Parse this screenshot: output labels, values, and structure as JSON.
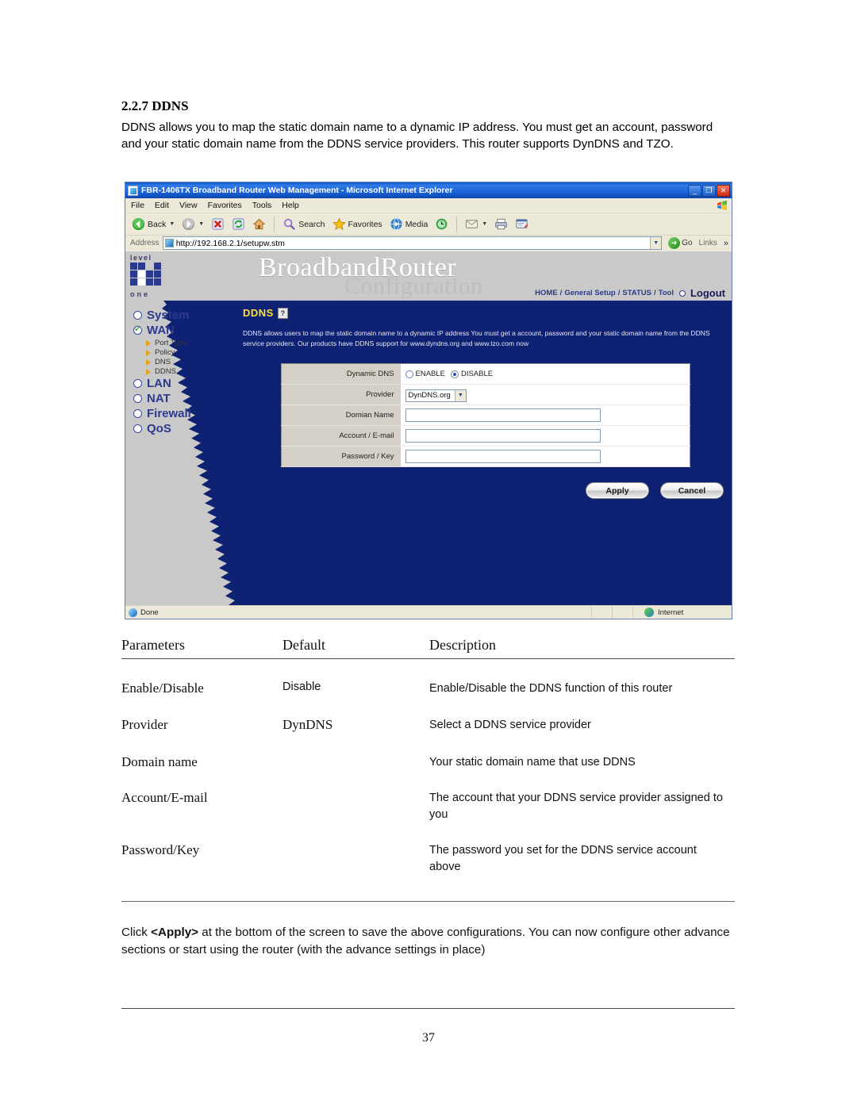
{
  "document": {
    "heading": "2.2.7 DDNS",
    "intro": "DDNS allows you to map the static domain name to a dynamic IP address. You must get an account, password and your static domain name from the DDNS service providers. This router supports DynDNS and TZO.",
    "page_number": "37",
    "footnote_prefix": "Click ",
    "footnote_bold": "<Apply>",
    "footnote_rest": " at the bottom of the screen to save the above configurations. You can now configure other advance sections or start using the router (with the advance settings in place)"
  },
  "browser": {
    "title": "FBR-1406TX Broadband Router Web Management - Microsoft Internet Explorer",
    "window_buttons": {
      "minimize": "_",
      "restore": "❐",
      "close": "✕"
    },
    "menu": [
      "File",
      "Edit",
      "View",
      "Favorites",
      "Tools",
      "Help"
    ],
    "toolbar": {
      "back": "Back",
      "forward": "",
      "stop": "",
      "refresh": "",
      "home": "",
      "search": "Search",
      "favorites": "Favorites",
      "media": "Media",
      "history": "",
      "mail": "",
      "print": "",
      "edit": ""
    },
    "address": {
      "label": "Address",
      "url": "http://192.168.2.1/setupw.stm",
      "go": "Go",
      "links": "Links",
      "overflow": "»"
    },
    "status": {
      "text": "Done",
      "zone": "Internet"
    }
  },
  "router": {
    "logo": {
      "top": "level",
      "sup": "\"",
      "bottom": "one"
    },
    "brand_main": "BroadbandRouter",
    "brand_sub": "Configuration",
    "nav": {
      "items": [
        "HOME",
        "General Setup",
        "STATUS",
        "Tool"
      ],
      "separator": "/",
      "logout": "Logout"
    },
    "sidebar": {
      "items": [
        {
          "label": "System",
          "checked": false
        },
        {
          "label": "WAN",
          "checked": true
        },
        {
          "label": "LAN",
          "checked": false
        },
        {
          "label": "NAT",
          "checked": false
        },
        {
          "label": "Firewall",
          "checked": false
        },
        {
          "label": "QoS",
          "checked": false
        }
      ],
      "wan_sub": [
        "Port Type",
        "Policy",
        "DNS",
        "DDNS"
      ]
    },
    "panel": {
      "title": "DDNS",
      "help_glyph": "?",
      "description": "DDNS allows users to map the static domain name to a dynamic IP address  You must get a account, password and your static domain name from the DDNS service providers. Our products have DDNS support for www.dyndns.org and www.tzo.com now"
    },
    "form": {
      "rows": [
        {
          "label": "Dynamic DNS",
          "type": "radio",
          "options": [
            "ENABLE",
            "DISABLE"
          ],
          "selected": "DISABLE"
        },
        {
          "label": "Provider",
          "type": "select",
          "value": "DynDNS.org"
        },
        {
          "label": "Domian Name",
          "type": "text",
          "value": ""
        },
        {
          "label": "Account / E-mail",
          "type": "text",
          "value": ""
        },
        {
          "label": "Password / Key",
          "type": "text",
          "value": ""
        }
      ],
      "apply": "Apply",
      "cancel": "Cancel"
    },
    "colors": {
      "panel_navy": "#0f2173",
      "page_gray": "#c9c9c9",
      "title_yellow": "#ffe033",
      "link_blue": "#2b3a8c"
    }
  },
  "parameters_table": {
    "headers": [
      "Parameters",
      "Default",
      "Description"
    ],
    "rows": [
      {
        "parameter": "Enable/Disable",
        "default": "Disable",
        "description": "Enable/Disable the DDNS function of this router"
      },
      {
        "parameter": "Provider",
        "default": "DynDNS",
        "description": "Select a DDNS service provider"
      },
      {
        "parameter": "Domain name",
        "default": "",
        "description": "Your static domain name that use DDNS"
      },
      {
        "parameter": "Account/E-mail",
        "default": "",
        "description": "The account that your DDNS service provider assigned to you"
      },
      {
        "parameter": "Password/Key",
        "default": "",
        "description": "The password you set for the DDNS service account above"
      }
    ]
  }
}
